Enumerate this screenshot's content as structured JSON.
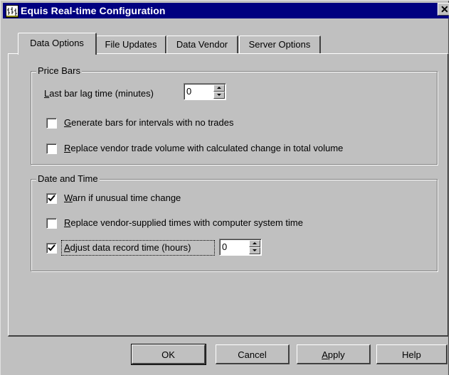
{
  "window": {
    "title": "Equis Real-time Configuration",
    "close_glyph": "✕"
  },
  "tabs": [
    {
      "label": "Data Options",
      "active": true
    },
    {
      "label": "File Updates",
      "active": false
    },
    {
      "label": "Data Vendor",
      "active": false
    },
    {
      "label": "Server Options",
      "active": false
    }
  ],
  "price_bars": {
    "title": "Price Bars",
    "lag_label": "Last bar lag time (minutes)",
    "lag_value": "0",
    "generate_label": "Generate bars for intervals with no trades",
    "generate_checked": false,
    "replace_volume_label": "Replace vendor trade volume with calculated change in total volume",
    "replace_volume_checked": false
  },
  "date_time": {
    "title": "Date and Time",
    "warn_label": "Warn if unusual time change",
    "warn_checked": true,
    "replace_times_label": "Replace vendor-supplied times with computer system time",
    "replace_times_checked": false,
    "adjust_label": "Adjust data record time (hours)",
    "adjust_checked": true,
    "adjust_value": "0"
  },
  "buttons": {
    "ok": "OK",
    "cancel": "Cancel",
    "apply": "Apply",
    "help": "Help"
  },
  "icons": {
    "app": "equis-chart-icon",
    "close": "close-icon",
    "check": "checkmark-icon",
    "spin_up": "spin-up-arrow-icon",
    "spin_down": "spin-down-arrow-icon"
  },
  "colors": {
    "title_bar": "#000080",
    "face": "#c0c0c0"
  }
}
